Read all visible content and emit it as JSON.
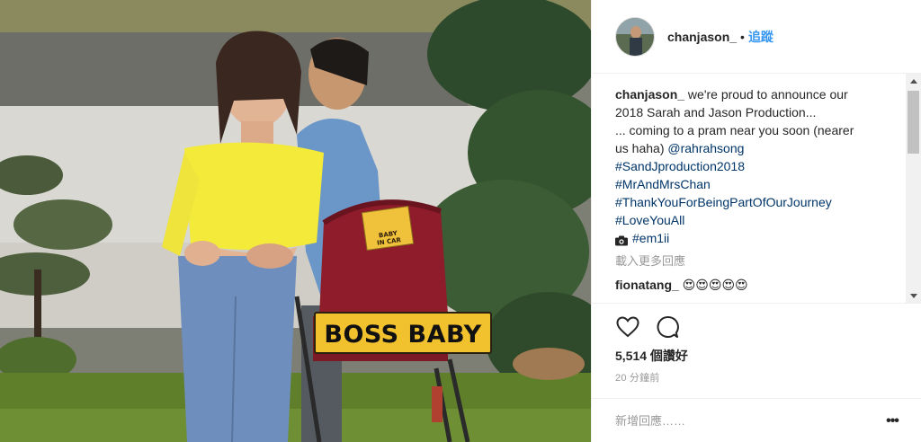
{
  "photo": {
    "plate_text": "BOSS BABY",
    "sticker_text": [
      "BABY",
      "IN CAR"
    ]
  },
  "header": {
    "username": "chanjason_",
    "separator": "•",
    "follow_label": "追蹤"
  },
  "caption": {
    "username": "chanjason_",
    "lines": [
      "we're proud to announce our",
      "2018 Sarah and Jason Production...",
      "... coming to a pram near you soon (nearer",
      "us haha)"
    ],
    "mention": "@rahrahsong",
    "hashtags": [
      "#SandJproduction2018",
      "#MrAndMrsChan",
      "#ThankYouForBeingPartOfOurJourney",
      "#LoveYouAll"
    ],
    "photo_credit": "#em1ii"
  },
  "comments": {
    "load_more_label": "載入更多回應",
    "items": [
      {
        "username": "fionatang_",
        "text": "😍😍😍😍😍"
      }
    ]
  },
  "actions": {
    "likes_text": "5,514 個讚好",
    "time_text": "20 分鐘前"
  },
  "add_comment": {
    "placeholder": "新增回應……",
    "more_label": "•••"
  },
  "colors": {
    "link_blue": "#3897f0",
    "hashtag_blue": "#003569",
    "muted_gray": "#999999",
    "text_dark": "#262626",
    "plate_yellow": "#f2c12e",
    "pram_red": "#8e1c2a"
  },
  "icons": {
    "like": "heart-icon",
    "comment": "speech-bubble-icon",
    "camera": "camera-icon",
    "more": "more-options-icon",
    "scroll_up": "arrow-up-icon",
    "scroll_down": "arrow-down-icon"
  }
}
